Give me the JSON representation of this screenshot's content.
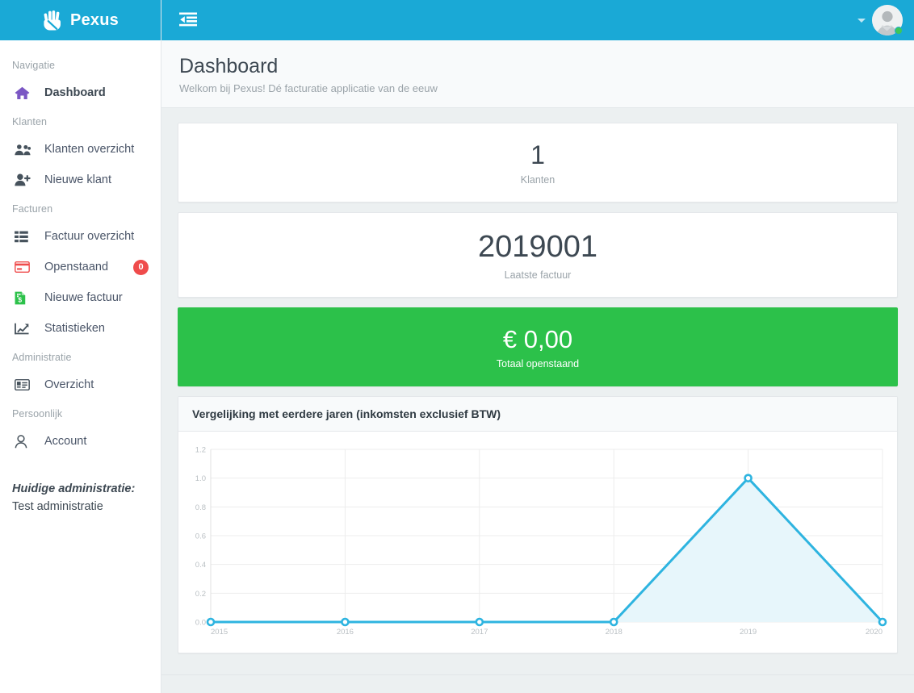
{
  "brand": {
    "name": "Pexus",
    "icon": "hand-paper-icon",
    "bg": "#1aa9d6"
  },
  "topbar": {
    "toggle_icon": "sidebar-collapse-icon",
    "caret_icon": "chevron-down-icon",
    "avatar_icon": "user-avatar",
    "status": "online"
  },
  "sidebar": {
    "groups": [
      {
        "heading": "Navigatie",
        "items": [
          {
            "label": "Dashboard",
            "icon": "home-icon",
            "icon_color": "#7b57c4",
            "active": true
          }
        ]
      },
      {
        "heading": "Klanten",
        "items": [
          {
            "label": "Klanten overzicht",
            "icon": "users-icon",
            "icon_color": "#46525c",
            "active": false
          },
          {
            "label": "Nieuwe klant",
            "icon": "user-plus-icon",
            "icon_color": "#46525c",
            "active": false
          }
        ]
      },
      {
        "heading": "Facturen",
        "items": [
          {
            "label": "Factuur overzicht",
            "icon": "list-icon",
            "icon_color": "#46525c",
            "active": false
          },
          {
            "label": "Openstaand",
            "icon": "credit-card-icon",
            "icon_color": "#ef4b4b",
            "active": false,
            "badge": "0"
          },
          {
            "label": "Nieuwe factuur",
            "icon": "invoice-money-icon",
            "icon_color": "#2cc14a",
            "active": false
          },
          {
            "label": "Statistieken",
            "icon": "chart-line-icon",
            "icon_color": "#46525c",
            "active": false
          }
        ]
      },
      {
        "heading": "Administratie",
        "items": [
          {
            "label": "Overzicht",
            "icon": "address-card-icon",
            "icon_color": "#46525c",
            "active": false
          }
        ]
      },
      {
        "heading": "Persoonlijk",
        "items": [
          {
            "label": "Account",
            "icon": "user-icon",
            "icon_color": "#46525c",
            "active": false
          }
        ]
      }
    ],
    "administration": {
      "title": "Huidige administratie:",
      "name": "Test administratie"
    }
  },
  "page": {
    "title": "Dashboard",
    "subtitle": "Welkom bij Pexus! Dé facturatie applicatie van de eeuw"
  },
  "cards": {
    "klanten": {
      "value": "1",
      "label": "Klanten"
    },
    "laatste_factuur": {
      "value": "2019001",
      "label": "Laatste factuur"
    },
    "totaal_openstaand": {
      "value": "€ 0,00",
      "label": "Totaal openstaand",
      "bg": "#2cc14a"
    }
  },
  "chart_panel": {
    "title": "Vergelijking met eerdere jaren (inkomsten exclusief BTW)"
  },
  "chart_data": {
    "type": "line",
    "title": "Vergelijking met eerdere jaren (inkomsten exclusief BTW)",
    "xlabel": "",
    "ylabel": "",
    "categories": [
      "2015",
      "2016",
      "2017",
      "2018",
      "2019",
      "2020"
    ],
    "x": [
      2015,
      2016,
      2017,
      2018,
      2019,
      2020
    ],
    "series": [
      {
        "name": "Inkomsten exclusief BTW",
        "values": [
          0.0,
          0.0,
          0.0,
          0.0,
          1.0,
          0.0
        ],
        "line_color": "#2eb4e0",
        "fill_color": "#e7f6fb",
        "marker": "open-circle"
      }
    ],
    "ytick_labels": [
      "0.0",
      "0.2",
      "0.4",
      "0.6",
      "0.8",
      "1.0",
      "1.2"
    ],
    "yticks": [
      0.0,
      0.2,
      0.4,
      0.6,
      0.8,
      1.0,
      1.2
    ],
    "ylim": [
      0.0,
      1.2
    ],
    "grid": true,
    "legend": false
  }
}
